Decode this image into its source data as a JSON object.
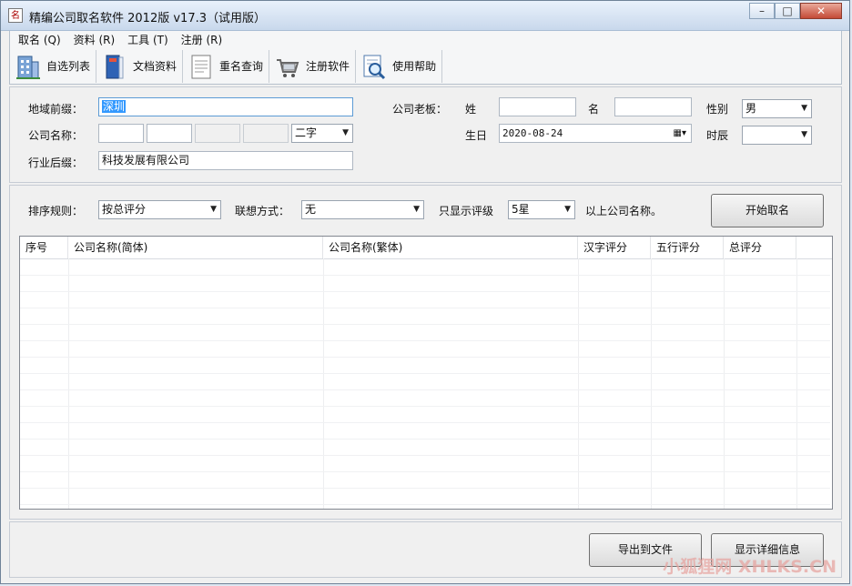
{
  "window": {
    "title": "精编公司取名软件 2012版 v17.3（试用版）",
    "app_icon_glyph": "名",
    "min_glyph": "–",
    "max_glyph": "□",
    "close_glyph": "✕"
  },
  "menu": [
    "取名 (Q)",
    "资料 (R)",
    "工具 (T)",
    "注册 (R)"
  ],
  "toolbar": [
    {
      "label": "自选列表",
      "icon": "building-icon"
    },
    {
      "label": "文档资料",
      "icon": "book-icon"
    },
    {
      "label": "重名查询",
      "icon": "document-icon"
    },
    {
      "label": "注册软件",
      "icon": "cart-icon"
    },
    {
      "label": "使用帮助",
      "icon": "help-search-icon"
    }
  ],
  "form": {
    "region_label": "地域前缀：",
    "region_value": "深圳",
    "company_label": "公司名称：",
    "company_len": "二字",
    "suffix_label": "行业后缀：",
    "suffix_value": "科技发展有限公司",
    "boss_label": "公司老板：",
    "surname_label": "姓",
    "given_label": "名",
    "gender_label": "性别",
    "gender_value": "男",
    "birth_label": "生日",
    "birth_value": "2020-08-24",
    "hour_label": "时辰",
    "hour_value": ""
  },
  "options": {
    "sort_label": "排序规则：",
    "sort_value": "按总评分",
    "assoc_label": "联想方式：",
    "assoc_value": "无",
    "filter_label": "只显示评级",
    "filter_value": "5星",
    "filter_suffix": "以上公司名称。",
    "start_button": "开始取名"
  },
  "table": {
    "columns": [
      "序号",
      "公司名称(简体)",
      "公司名称(繁体)",
      "汉字评分",
      "五行评分",
      "总评分"
    ]
  },
  "footer": {
    "export_button": "导出到文件",
    "detail_button": "显示详细信息"
  },
  "watermark": "小狐狸网 XHLKS.CN"
}
